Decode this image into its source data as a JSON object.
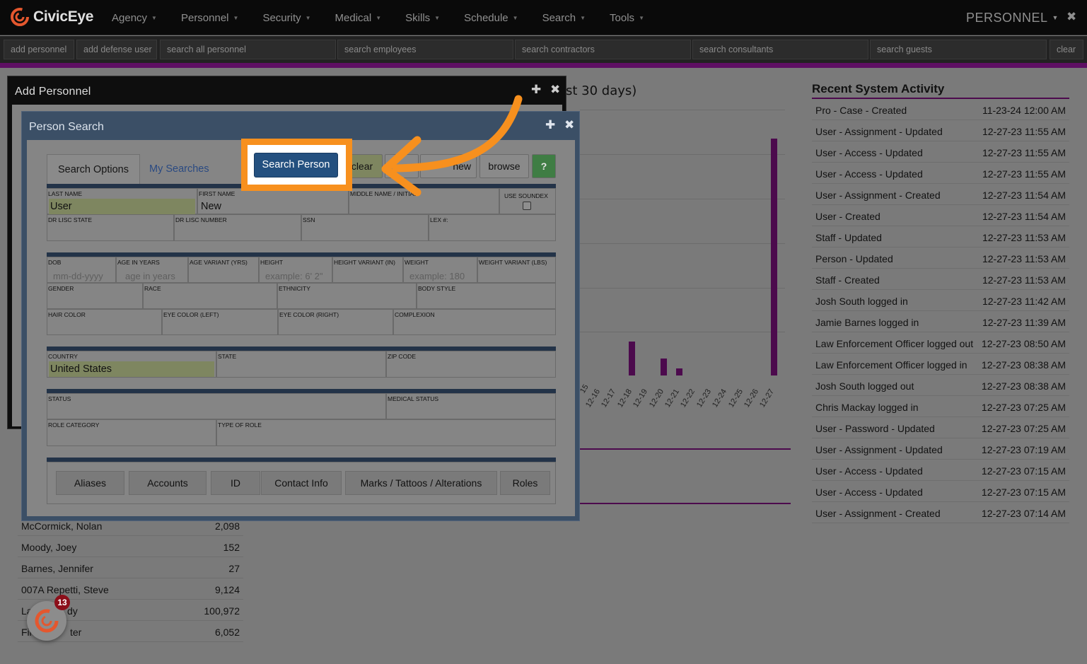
{
  "app": {
    "name": "CivicEye"
  },
  "nav": {
    "items": [
      "Agency",
      "Personnel",
      "Security",
      "Medical",
      "Skills",
      "Schedule",
      "Search",
      "Tools"
    ],
    "section_label": "PERSONNEL"
  },
  "subnav": {
    "add_personnel": "add personnel",
    "add_defense_user": "add defense user",
    "search_all_personnel": "search all personnel",
    "search_employees": "search employees",
    "search_contractors": "search contractors",
    "search_consultants": "search consultants",
    "search_guests": "search guests",
    "clear": "clear"
  },
  "chart": {
    "title_fragment": "st 30 days)",
    "tick_labels": [
      "15",
      "12-16",
      "12-17",
      "12-18",
      "12-19",
      "12-20",
      "12-21",
      "12-22",
      "12-23",
      "12-24",
      "12-25",
      "12-26",
      "12-27"
    ]
  },
  "chart_data": {
    "type": "bar",
    "title": "st 30 days)",
    "categories": [
      "12-18",
      "12-20",
      "12-21",
      "12-27"
    ],
    "values": [
      48,
      24,
      10,
      335
    ]
  },
  "activity": {
    "title": "Recent System Activity",
    "rows": [
      {
        "event": "Pro - Case - Created",
        "time": "11-23-24 12:00 AM"
      },
      {
        "event": "User - Assignment - Updated",
        "time": "12-27-23 11:55 AM"
      },
      {
        "event": "User - Access - Updated",
        "time": "12-27-23 11:55 AM"
      },
      {
        "event": "User - Access - Updated",
        "time": "12-27-23 11:55 AM"
      },
      {
        "event": "User - Assignment - Created",
        "time": "12-27-23 11:54 AM"
      },
      {
        "event": "User - Created",
        "time": "12-27-23 11:54 AM"
      },
      {
        "event": "Staff - Updated",
        "time": "12-27-23 11:53 AM"
      },
      {
        "event": "Person - Updated",
        "time": "12-27-23 11:53 AM"
      },
      {
        "event": "Staff - Created",
        "time": "12-27-23 11:53 AM"
      },
      {
        "event": "Josh South logged in",
        "time": "12-27-23 11:42 AM"
      },
      {
        "event": "Jamie Barnes logged in",
        "time": "12-27-23 11:39 AM"
      },
      {
        "event": "Law Enforcement Officer logged out",
        "time": "12-27-23 08:50 AM"
      },
      {
        "event": "Law Enforcement Officer logged in",
        "time": "12-27-23 08:38 AM"
      },
      {
        "event": "Josh South logged out",
        "time": "12-27-23 08:38 AM"
      },
      {
        "event": "Chris Mackay logged in",
        "time": "12-27-23 07:25 AM"
      },
      {
        "event": "User - Password - Updated",
        "time": "12-27-23 07:25 AM"
      },
      {
        "event": "User - Assignment - Updated",
        "time": "12-27-23 07:19 AM"
      },
      {
        "event": "User - Access - Updated",
        "time": "12-27-23 07:15 AM"
      },
      {
        "event": "User - Access - Updated",
        "time": "12-27-23 07:15 AM"
      },
      {
        "event": "User - Assignment - Created",
        "time": "12-27-23 07:14 AM"
      }
    ]
  },
  "people_list": [
    {
      "name": "McCormick, Nolan",
      "value": "2,098"
    },
    {
      "name": "Moody, Joey",
      "value": "152"
    },
    {
      "name": "Barnes, Jennifer",
      "value": "27"
    },
    {
      "name": "007A Repetti, Steve",
      "value": "9,124"
    },
    {
      "name": "La",
      "name_tail": "dy",
      "value": "100,972"
    },
    {
      "name": "File",
      "name_tail": "ter",
      "value": "6,052"
    }
  ],
  "add_window": {
    "title": "Add Personnel"
  },
  "search_window": {
    "title": "Person Search",
    "tabs": {
      "options": "Search Options",
      "my_searches": "My Searches"
    },
    "buttons": {
      "search": "Search Person",
      "clear": "clear",
      "new": "new",
      "browse": "browse",
      "help": "?"
    },
    "fields": {
      "last_name": {
        "label": "LAST NAME",
        "value": "User"
      },
      "first_name": {
        "label": "FIRST NAME",
        "value": "New"
      },
      "middle_name": {
        "label": "MIDDLE NAME / INITIAL"
      },
      "use_soundex": {
        "label": "USE SOUNDEX"
      },
      "dr_lisc_state": {
        "label": "DR LISC STATE"
      },
      "dr_lisc_number": {
        "label": "DR LISC NUMBER"
      },
      "ssn": {
        "label": "SSN"
      },
      "lex": {
        "label": "LEX #:"
      },
      "dob": {
        "label": "DOB",
        "placeholder": "mm-dd-yyyy"
      },
      "age_years": {
        "label": "AGE IN YEARS",
        "placeholder": "age in years"
      },
      "age_variant": {
        "label": "AGE VARIANT (YRS)"
      },
      "height": {
        "label": "HEIGHT",
        "placeholder": "example: 6' 2\""
      },
      "height_variant": {
        "label": "HEIGHT VARIANT (IN)"
      },
      "weight": {
        "label": "WEIGHT",
        "placeholder": "example: 180"
      },
      "weight_variant": {
        "label": "WEIGHT VARIANT (LBS)"
      },
      "gender": {
        "label": "GENDER"
      },
      "race": {
        "label": "RACE"
      },
      "ethnicity": {
        "label": "ETHNICITY"
      },
      "body_style": {
        "label": "BODY STYLE"
      },
      "hair_color": {
        "label": "HAIR COLOR"
      },
      "eye_left": {
        "label": "EYE COLOR (LEFT)"
      },
      "eye_right": {
        "label": "EYE COLOR (RIGHT)"
      },
      "complexion": {
        "label": "COMPLEXION"
      },
      "country": {
        "label": "COUNTRY",
        "value": "United States"
      },
      "state": {
        "label": "STATE"
      },
      "zip": {
        "label": "ZIP CODE"
      },
      "status": {
        "label": "STATUS"
      },
      "medical_status": {
        "label": "MEDICAL STATUS"
      },
      "role_category": {
        "label": "ROLE CATEGORY"
      },
      "type_of_role": {
        "label": "TYPE OF ROLE"
      }
    },
    "bottom_buttons": [
      "Aliases",
      "Accounts",
      "ID",
      "Contact Info",
      "Marks / Tattoos / Alterations",
      "Roles"
    ]
  },
  "chat": {
    "badge_count": "13"
  },
  "colors": {
    "accent": "#5e0f63",
    "highlight": "#f7901e",
    "primary_button": "#24507f"
  }
}
